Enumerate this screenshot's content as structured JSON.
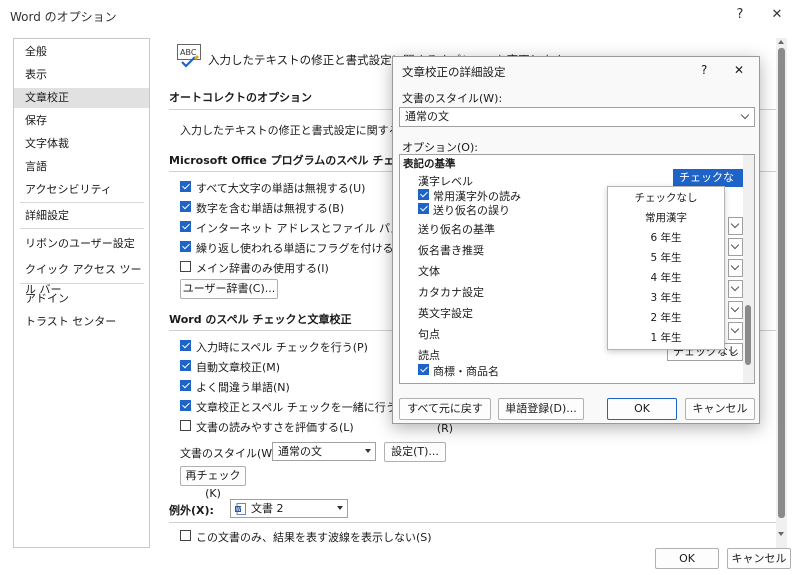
{
  "window": {
    "title": "Word のオプション",
    "help": "?",
    "close": "✕"
  },
  "sidebar": {
    "items": [
      "全般",
      "表示",
      "文章校正",
      "保存",
      "文字体裁",
      "言語",
      "アクセシビリティ",
      "詳細設定",
      "リボンのユーザー設定",
      "クイック アクセス ツール バー",
      "アドイン",
      "トラスト センター"
    ]
  },
  "main": {
    "header_text": "入力したテキストの修正と書式設定に関するオプションを変更します。",
    "autocorrect": {
      "title": "オートコレクトのオプション",
      "desc": "入力したテキストの修正と書式設定に関するオプション"
    },
    "office_spell": {
      "title": "Microsoft Office プログラムのスペル チェック",
      "options": [
        {
          "label": "すべて大文字の単語は無視する(U)",
          "checked": true
        },
        {
          "label": "数字を含む単語は無視する(B)",
          "checked": true
        },
        {
          "label": "インターネット アドレスとファイル パスは無視する(F)",
          "checked": true
        },
        {
          "label": "繰り返し使われる単語にフラグを付ける(R)",
          "checked": true
        },
        {
          "label": "メイン辞書のみ使用する(I)",
          "checked": false
        }
      ],
      "custom_dict_button": "ユーザー辞書(C)..."
    },
    "word_spell": {
      "title": "Word のスペル チェックと文章校正",
      "options": [
        {
          "label": "入力時にスペル チェックを行う(P)",
          "checked": true
        },
        {
          "label": "自動文章校正(M)",
          "checked": true
        },
        {
          "label": "よく間違う単語(N)",
          "checked": true
        },
        {
          "label": "文章校正とスペル チェックを一緒に行う(H)",
          "checked": true
        },
        {
          "label": "文書の読みやすさを評価する(L)",
          "checked": false
        }
      ],
      "style_label": "文書のスタイル(W):",
      "style_value": "通常の文",
      "settings_button": "設定(T)...",
      "recheck_button": "再チェック(K)"
    },
    "exceptions": {
      "label": "例外(X):",
      "doc_value": "文書 2",
      "option": {
        "label": "この文書のみ、結果を表す波線を表示しない(S)",
        "checked": false
      }
    }
  },
  "footer": {
    "ok": "OK",
    "cancel": "キャンセル"
  },
  "dialog": {
    "title": "文章校正の詳細設定",
    "help": "?",
    "close": "✕",
    "style_label": "文書のスタイル(W):",
    "style_value": "通常の文",
    "options_label": "オプション(O):",
    "group_header": "表記の基準",
    "rows": [
      {
        "label": "漢字レベル",
        "value": "チェックなし",
        "type": "combo"
      },
      {
        "label": "常用漢字外の読み",
        "type": "check",
        "checked": true
      },
      {
        "label": "送り仮名の誤り",
        "type": "check",
        "checked": true
      },
      {
        "label": "送り仮名の基準",
        "type": "combo"
      },
      {
        "label": "仮名書き推奨",
        "type": "combo"
      },
      {
        "label": "文体",
        "type": "combo"
      },
      {
        "label": "カタカナ設定",
        "type": "combo"
      },
      {
        "label": "英文字設定",
        "type": "combo"
      },
      {
        "label": "句点",
        "type": "combo"
      },
      {
        "label": "読点",
        "value": "チェックなし",
        "type": "combo"
      },
      {
        "label": "商標・商品名",
        "type": "check",
        "checked": true
      }
    ],
    "reset_button": "すべて元に戻す(R)",
    "word_register_button": "単語登録(D)...",
    "ok": "OK",
    "cancel": "キャンセル",
    "dropdown_options": [
      "チェックなし",
      "常用漢字",
      "6 年生",
      "5 年生",
      "4 年生",
      "3 年生",
      "2 年生",
      "1 年生"
    ]
  }
}
